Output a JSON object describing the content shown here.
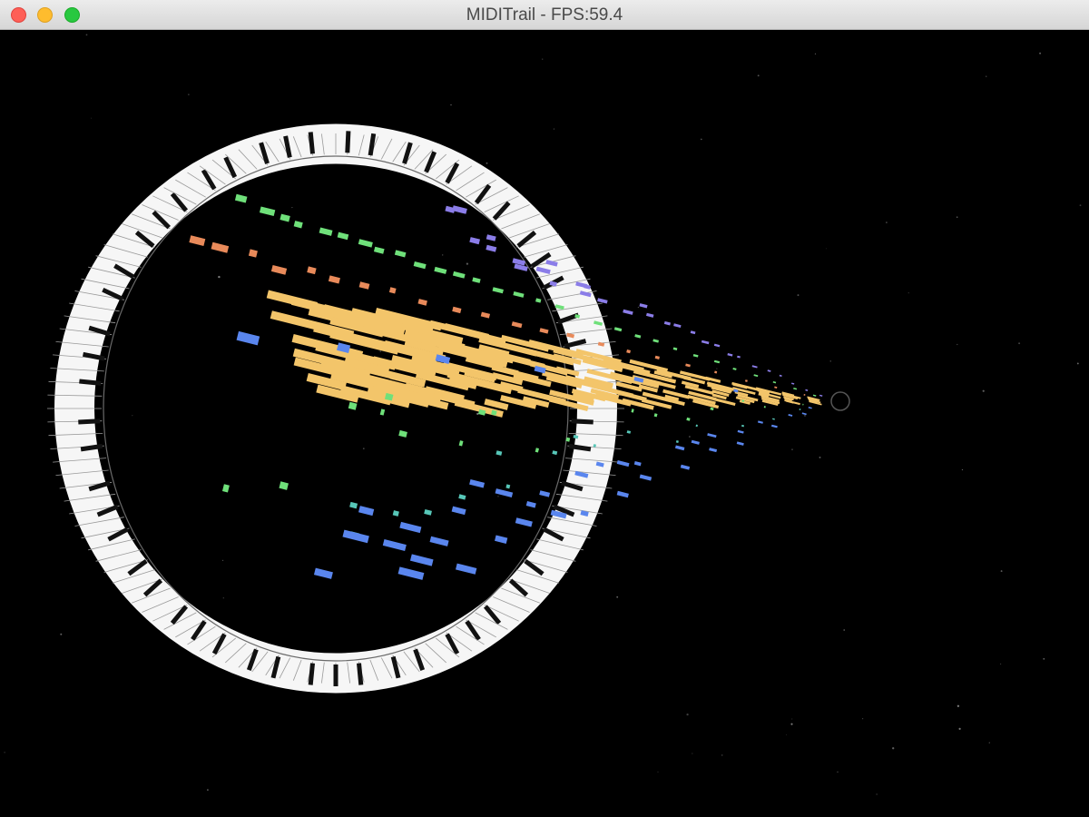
{
  "window": {
    "title": "MIDITrail - FPS:59.4",
    "buttons": {
      "close": "close-button",
      "minimize": "minimize-button",
      "zoom": "zoom-button"
    }
  },
  "colors": {
    "background": "#000000",
    "keys_white": "#f6f6f6",
    "keys_black": "#111111",
    "note_orange": "#e88a5a",
    "note_yellow": "#f3c56a",
    "note_green": "#6fe07a",
    "note_purple": "#8b7de8",
    "note_blue": "#5a86ee",
    "note_teal": "#57c7b8"
  }
}
